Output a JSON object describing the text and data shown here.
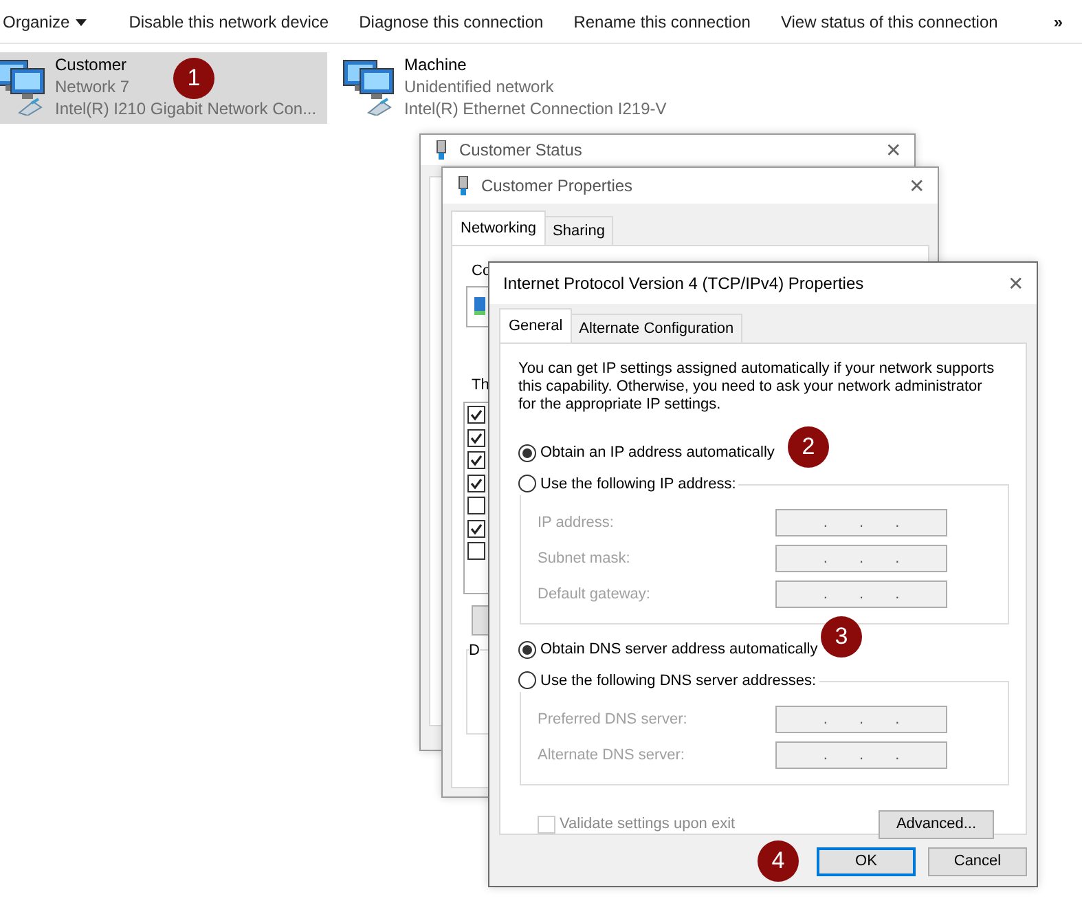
{
  "toolbar": {
    "items": [
      {
        "label": "Organize",
        "kind": "menu"
      },
      {
        "label": "Disable this network device",
        "kind": "command"
      },
      {
        "label": "Diagnose this connection",
        "kind": "command"
      },
      {
        "label": "Rename this connection",
        "kind": "command"
      },
      {
        "label": "View status of this connection",
        "kind": "command"
      }
    ],
    "overflow": "»"
  },
  "connections": [
    {
      "name": "Customer",
      "status": "Network 7",
      "adapter": "Intel(R) I210 Gigabit Network Con...",
      "selected": true,
      "step": "1"
    },
    {
      "name": "Machine",
      "status": "Unidentified network",
      "adapter": "Intel(R) Ethernet Connection I219-V",
      "selected": false
    }
  ],
  "status_window": {
    "title": "Customer Status",
    "close": "✕"
  },
  "properties_window": {
    "title": "Customer Properties",
    "close": "✕",
    "tabs": [
      {
        "label": "Networking",
        "selected": true
      },
      {
        "label": "Sharing",
        "selected": false
      }
    ],
    "connect_label": "Co",
    "components_label": "Th",
    "component_checks": [
      true,
      true,
      true,
      true,
      false,
      true,
      false
    ],
    "details_label": "D"
  },
  "ipv4_dialog": {
    "title": "Internet Protocol Version 4 (TCP/IPv4) Properties",
    "close": "✕",
    "tabs": [
      {
        "label": "General",
        "selected": true
      },
      {
        "label": "Alternate Configuration",
        "selected": false
      }
    ],
    "intro": "You can get IP settings assigned automatically if your network supports this capability. Otherwise, you need to ask your network administrator for the appropriate IP settings.",
    "ip_options": [
      {
        "label": "Obtain an IP address automatically",
        "selected": true,
        "step": "2"
      },
      {
        "label": "Use the following IP address:",
        "selected": false
      }
    ],
    "ip_fields": [
      {
        "label": "IP address:",
        "value": ". . ."
      },
      {
        "label": "Subnet mask:",
        "value": ". . ."
      },
      {
        "label": "Default gateway:",
        "value": ". . ."
      }
    ],
    "dns_options": [
      {
        "label": "Obtain DNS server address automatically",
        "selected": true,
        "step": "3"
      },
      {
        "label": "Use the following DNS server addresses:",
        "selected": false
      }
    ],
    "dns_fields": [
      {
        "label": "Preferred DNS server:",
        "value": ". . ."
      },
      {
        "label": "Alternate DNS server:",
        "value": ". . ."
      }
    ],
    "validate": {
      "label": "Validate settings upon exit",
      "checked": false,
      "disabled": true
    },
    "advanced_button": "Advanced...",
    "buttons": [
      {
        "label": "OK",
        "focused": true,
        "step": "4"
      },
      {
        "label": "Cancel",
        "focused": false
      }
    ]
  }
}
